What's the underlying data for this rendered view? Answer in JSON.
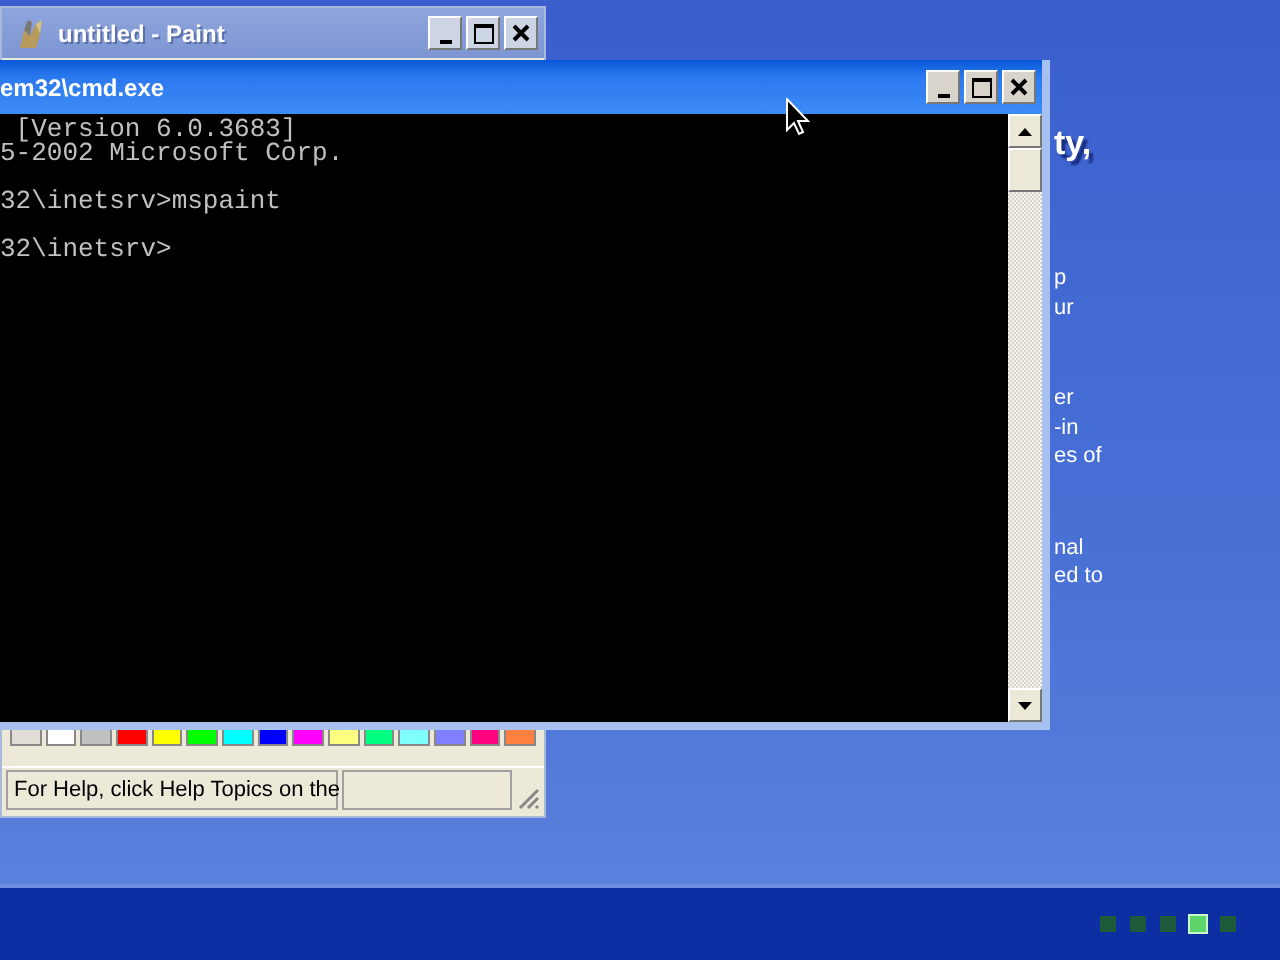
{
  "desktop": {
    "paragraphs": [
      {
        "kind": "heading",
        "lines": [
          "ty,"
        ]
      },
      {
        "kind": "body",
        "lines": [
          "p",
          "ur"
        ]
      },
      {
        "kind": "body",
        "lines": [
          "er",
          "-in",
          "es of"
        ]
      },
      {
        "kind": "body",
        "lines": [
          "nal",
          "ed to"
        ]
      }
    ],
    "progress_dots": [
      {
        "selected": false
      },
      {
        "selected": false
      },
      {
        "selected": false
      },
      {
        "selected": true
      },
      {
        "selected": false
      }
    ]
  },
  "paint_window": {
    "title": "untitled - Paint",
    "active": false,
    "palette": [
      {
        "color": "#e0ddd6"
      },
      {
        "color": "#ffffff"
      },
      {
        "color": "#c0c0c0"
      },
      {
        "color": "#ff0000"
      },
      {
        "color": "#ffff00"
      },
      {
        "color": "#00ff00"
      },
      {
        "color": "#00ffff"
      },
      {
        "color": "#0000ff"
      },
      {
        "color": "#ff00ff"
      },
      {
        "color": "#ffff80"
      },
      {
        "color": "#00ff80"
      },
      {
        "color": "#80ffff"
      },
      {
        "color": "#8080ff"
      },
      {
        "color": "#ff0080"
      },
      {
        "color": "#ff8040"
      }
    ],
    "status_text": "For Help, click Help Topics on the"
  },
  "cmd_window": {
    "title": "em32\\cmd.exe",
    "active": true,
    "lines": [
      {
        "kind": "line",
        "text": " [Version 6.0.3683]"
      },
      {
        "kind": "line",
        "text": "5-2002 Microsoft Corp."
      },
      {
        "kind": "after_blank",
        "text": "32\\inetsrv>mspaint"
      },
      {
        "kind": "after_blank",
        "text": "32\\inetsrv>"
      }
    ]
  }
}
